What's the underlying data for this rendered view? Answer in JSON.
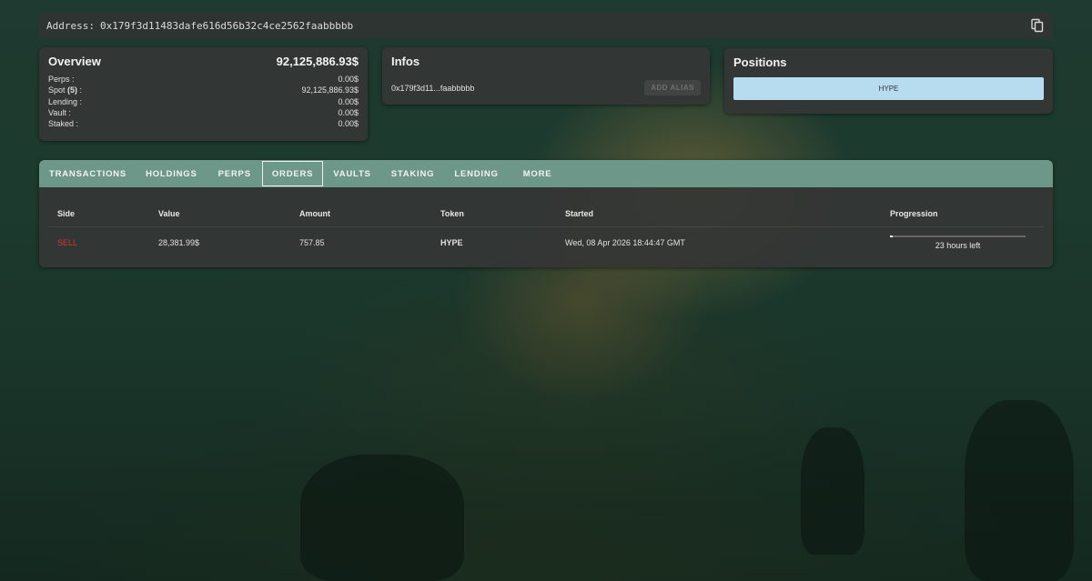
{
  "address": {
    "label": "Address:",
    "value": "0x179f3d11483dafe616d56b32c4ce2562faabbbbb"
  },
  "overview": {
    "title": "Overview",
    "total": "92,125,886.93$",
    "rows": [
      {
        "label": "Perps :",
        "value": "0.00$"
      },
      {
        "label_prefix": "Spot",
        "label_count": "(5)",
        "label_suffix": ":",
        "value": "92,125,886.93$"
      },
      {
        "label": "Lending :",
        "value": "0.00$"
      },
      {
        "label": "Vault :",
        "value": "0.00$"
      },
      {
        "label": "Staked :",
        "value": "0.00$"
      }
    ]
  },
  "infos": {
    "title": "Infos",
    "short_address": "0x179f3d11...faabbbbb",
    "add_alias_label": "ADD ALIAS"
  },
  "positions": {
    "title": "Positions",
    "items": [
      {
        "label": "HYPE",
        "color": "#b7dcef"
      }
    ]
  },
  "tabs": [
    {
      "label": "TRANSACTIONS",
      "active": false
    },
    {
      "label": "HOLDINGS",
      "active": false
    },
    {
      "label": "PERPS",
      "active": false
    },
    {
      "label": "ORDERS",
      "active": true
    },
    {
      "label": "VAULTS",
      "active": false
    },
    {
      "label": "STAKING",
      "active": false
    },
    {
      "label": "LENDING",
      "active": false
    },
    {
      "label": "MORE",
      "active": false
    }
  ],
  "orders": {
    "columns": [
      "Side",
      "Value",
      "Amount",
      "Token",
      "Started",
      "Progression"
    ],
    "rows": [
      {
        "side": "SELL",
        "value": "28,381.99$",
        "amount": "757.85",
        "token": "HYPE",
        "started": "Wed, 08 Apr 2026 18:44:47 GMT",
        "progress_fraction": 0.02,
        "progress_text": "23 hours left"
      }
    ]
  },
  "colors": {
    "accent_tab_bar": "#6d9789",
    "sell": "#d33a2f",
    "position_bar": "#b7dcef"
  },
  "icons": {
    "copy": "copy-icon"
  }
}
